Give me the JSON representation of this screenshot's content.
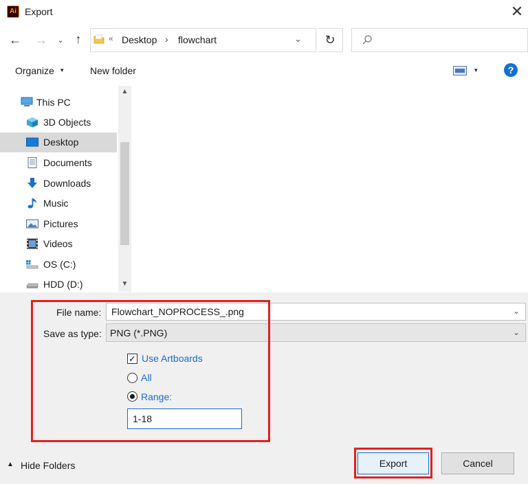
{
  "window": {
    "app_badge": "Ai",
    "title": "Export",
    "close_glyph": "✕"
  },
  "nav": {
    "back_glyph": "←",
    "forward_glyph": "→",
    "recent_glyph": "⌄",
    "up_glyph": "↑"
  },
  "address": {
    "overflow": "«",
    "crumbs": [
      "Desktop",
      "flowchart"
    ],
    "separator": "›",
    "dropdown_glyph": "⌄"
  },
  "refresh_glyph": "↻",
  "search": {
    "placeholder": ""
  },
  "toolbar": {
    "organize_label": "Organize",
    "caret": "▾",
    "new_folder_label": "New folder",
    "help_glyph": "?"
  },
  "sidebar": {
    "items": [
      {
        "label": "This PC",
        "icon": "computer-icon"
      },
      {
        "label": "3D Objects",
        "icon": "cube-icon"
      },
      {
        "label": "Desktop",
        "icon": "desktop-icon",
        "selected": true
      },
      {
        "label": "Documents",
        "icon": "document-icon"
      },
      {
        "label": "Downloads",
        "icon": "download-icon"
      },
      {
        "label": "Music",
        "icon": "music-icon"
      },
      {
        "label": "Pictures",
        "icon": "pictures-icon"
      },
      {
        "label": "Videos",
        "icon": "videos-icon"
      },
      {
        "label": "OS (C:)",
        "icon": "drive-icon"
      },
      {
        "label": "HDD (D:)",
        "icon": "drive-icon"
      }
    ],
    "scroll_up_glyph": "▲",
    "scroll_down_glyph": "▼"
  },
  "form": {
    "file_name_label": "File name:",
    "file_name_value": "Flowchart_NOPROCESS_.png",
    "save_type_label": "Save as type:",
    "save_type_value": "PNG (*.PNG)",
    "dropdown_glyph": "⌄",
    "use_artboards_label": "Use Artboards",
    "use_artboards_checked": true,
    "check_glyph": "✓",
    "all_label": "All",
    "range_label": "Range:",
    "range_value": "1-18"
  },
  "footer": {
    "hide_folders_label": "Hide Folders",
    "hide_caret": "▲",
    "export_label": "Export",
    "cancel_label": "Cancel"
  },
  "colors": {
    "accent": "#1b6ac9",
    "highlight": "#e02020",
    "selected_bg": "#d9d9d9",
    "panel_bg": "#f0f0f0"
  }
}
